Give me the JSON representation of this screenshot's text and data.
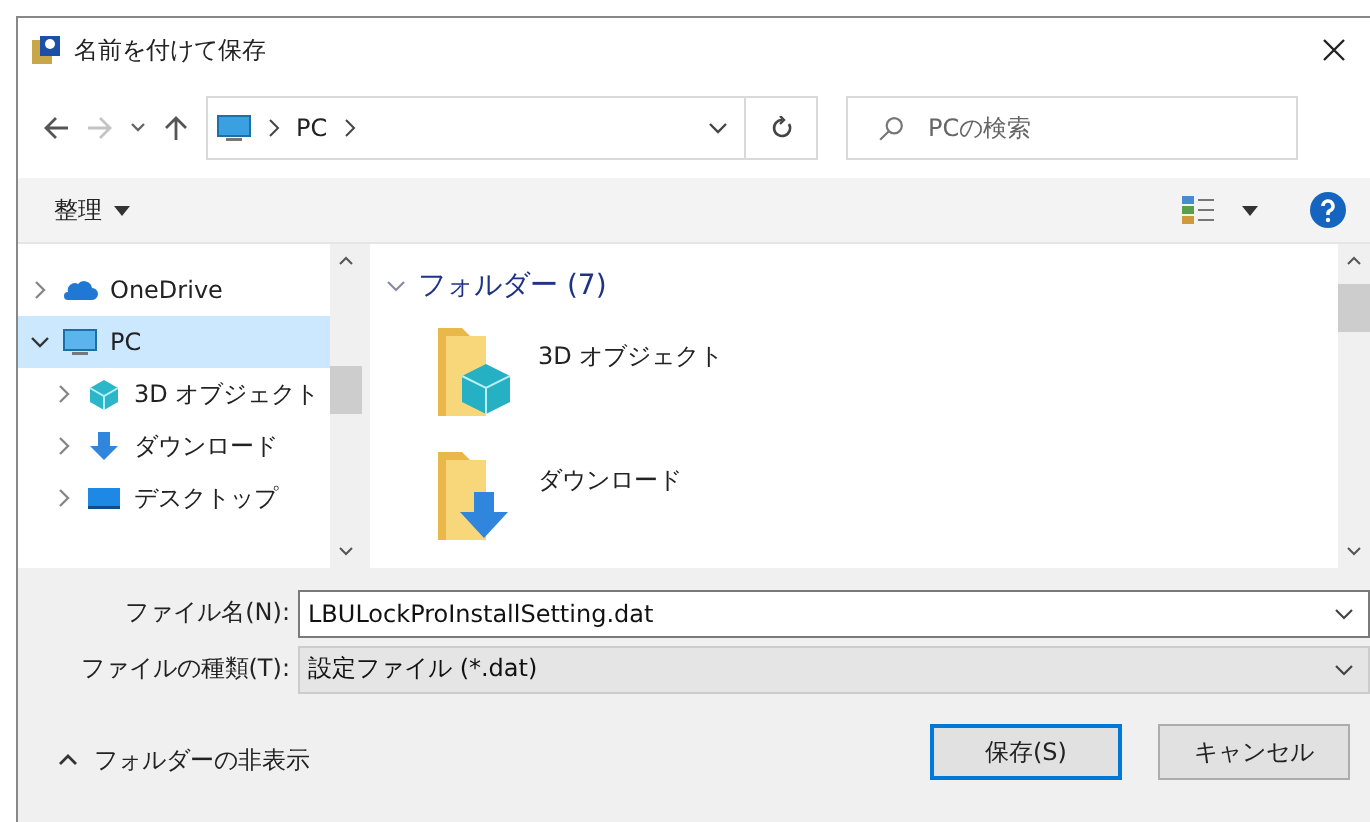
{
  "window": {
    "title": "名前を付けて保存"
  },
  "address": {
    "crumbs": [
      "PC"
    ]
  },
  "search": {
    "placeholder": "PCの検索"
  },
  "toolbar": {
    "organize": "整理"
  },
  "nav": {
    "items": [
      {
        "label": "OneDrive",
        "kind": "cloud",
        "expanded": false,
        "selected": false
      },
      {
        "label": "PC",
        "kind": "pc",
        "expanded": true,
        "selected": true,
        "children": [
          {
            "label": "3D オブジェクト",
            "kind": "objects3d",
            "expanded": false,
            "selected": false
          },
          {
            "label": "ダウンロード",
            "kind": "downloads",
            "expanded": false,
            "selected": false
          },
          {
            "label": "デスクトップ",
            "kind": "desktop",
            "expanded": false,
            "selected": false
          }
        ]
      }
    ]
  },
  "content": {
    "group": {
      "label": "フォルダー (7)",
      "expanded": true
    },
    "items": [
      {
        "label": "3D オブジェクト",
        "kind": "objects3d"
      },
      {
        "label": "ダウンロード",
        "kind": "downloads"
      }
    ]
  },
  "fields": [
    {
      "label": "ファイル名(N):",
      "value": "LBULockProInstallSetting.dat",
      "kind": "edit"
    },
    {
      "label": "ファイルの種類(T):",
      "value": "設定ファイル (*.dat)",
      "kind": "select"
    }
  ],
  "footer": {
    "toggle": "フォルダーの非表示",
    "buttons": [
      {
        "label": "保存(S)",
        "default": true
      },
      {
        "label": "キャンセル",
        "default": false
      }
    ]
  }
}
